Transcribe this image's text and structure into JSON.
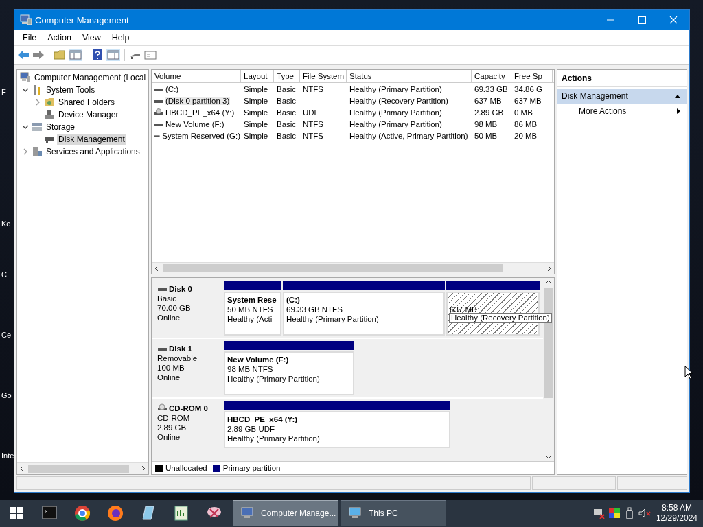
{
  "desktop_labels": [
    "F",
    "Ke",
    "C",
    "Ce",
    "Go",
    "Inte"
  ],
  "window": {
    "title": "Computer Management"
  },
  "menu": [
    "File",
    "Action",
    "View",
    "Help"
  ],
  "tree": [
    {
      "label": "Computer Management (Local",
      "selected": false,
      "children": [
        {
          "label": "System Tools",
          "expanded": true,
          "selected": false,
          "children": [
            {
              "label": "Shared Folders",
              "expanded": false,
              "selected": false
            },
            {
              "label": "Device Manager",
              "selected": false
            }
          ]
        },
        {
          "label": "Storage",
          "expanded": true,
          "selected": false,
          "children": [
            {
              "label": "Disk Management",
              "selected": true
            }
          ]
        },
        {
          "label": "Services and Applications",
          "expanded": false,
          "selected": false
        }
      ]
    }
  ],
  "volumes": {
    "columns": [
      "Volume",
      "Layout",
      "Type",
      "File System",
      "Status",
      "Capacity",
      "Free Sp"
    ],
    "rows": [
      {
        "cells": [
          "(C:)",
          "Simple",
          "Basic",
          "NTFS",
          "Healthy (Primary Partition)",
          "69.33 GB",
          "34.86 G"
        ],
        "selected": false
      },
      {
        "cells": [
          "(Disk 0 partition 3)",
          "Simple",
          "Basic",
          "",
          "Healthy (Recovery Partition)",
          "637 MB",
          "637 MB"
        ],
        "selected": true
      },
      {
        "cells": [
          "HBCD_PE_x64 (Y:)",
          "Simple",
          "Basic",
          "UDF",
          "Healthy (Primary Partition)",
          "2.89 GB",
          "0 MB"
        ],
        "selected": false
      },
      {
        "cells": [
          "New Volume (F:)",
          "Simple",
          "Basic",
          "NTFS",
          "Healthy (Primary Partition)",
          "98 MB",
          "86 MB"
        ],
        "selected": false
      },
      {
        "cells": [
          "System Reserved (G:)",
          "Simple",
          "Basic",
          "NTFS",
          "Healthy (Active, Primary Partition)",
          "50 MB",
          "20 MB"
        ],
        "selected": false
      }
    ]
  },
  "disks": [
    {
      "name": "Disk 0",
      "type": "Basic",
      "size": "70.00 GB",
      "status": "Online",
      "partitions": [
        {
          "name": "System Rese",
          "size_fs": "50 MB NTFS",
          "status": "Healthy (Acti",
          "selected": false
        },
        {
          "name": "(C:)",
          "size_fs": "69.33 GB NTFS",
          "status": "Healthy (Primary Partition)",
          "selected": false
        },
        {
          "size_fs": "637 MB",
          "tooltip": "Healthy (Recovery Partition)",
          "selected": true
        }
      ]
    },
    {
      "name": "Disk 1",
      "type": "Removable",
      "size": "100 MB",
      "status": "Online",
      "partitions": [
        {
          "name": "New Volume  (F:)",
          "size_fs": "98 MB NTFS",
          "status": "Healthy (Primary Partition)",
          "selected": false
        }
      ]
    },
    {
      "name": "CD-ROM 0",
      "type": "CD-ROM",
      "size": "2.89 GB",
      "status": "Online",
      "partitions": [
        {
          "name": "HBCD_PE_x64  (Y:)",
          "size_fs": "2.89 GB UDF",
          "status": "Healthy (Primary Partition)",
          "selected": false
        }
      ]
    }
  ],
  "legend": [
    {
      "label": "Unallocated",
      "color": "#000000"
    },
    {
      "label": "Primary partition",
      "color": "#000080"
    }
  ],
  "actions": {
    "title": "Actions",
    "section": "Disk Management",
    "items": [
      "More Actions"
    ]
  },
  "taskbar": {
    "windows": [
      {
        "label": "Computer Manage...",
        "selected": true
      },
      {
        "label": "This PC",
        "selected": false
      }
    ],
    "time": "8:58 AM",
    "date": "12/29/2024"
  }
}
